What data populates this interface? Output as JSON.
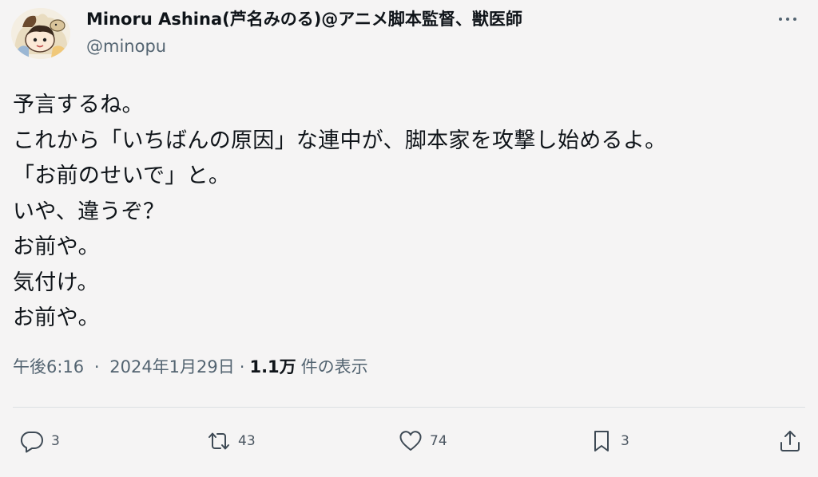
{
  "author": {
    "display_name": "Minoru Ashina(芦名みのる)@アニメ脚本監督、獣医師",
    "handle": "@minopu"
  },
  "more_icon": "more-horizontal-icon",
  "tweet": {
    "lines": [
      "予言するね。",
      "これから「いちばんの原因」な連中が、脚本家を攻撃し始めるよ。",
      "「お前のせいで」と。",
      "いや、違うぞ？",
      "お前や。",
      "気付け。",
      "お前や。"
    ]
  },
  "meta": {
    "time": "午後6:16",
    "separator": "·",
    "date": "2024年1月29日",
    "views_count": "1.1万",
    "views_label": "件の表示"
  },
  "actions": {
    "reply": {
      "icon": "reply-icon",
      "count": "3"
    },
    "repost": {
      "icon": "repost-icon",
      "count": "43"
    },
    "like": {
      "icon": "heart-icon",
      "count": "74"
    },
    "bookmark": {
      "icon": "bookmark-icon",
      "count": "3"
    },
    "share": {
      "icon": "share-icon"
    }
  },
  "colors": {
    "background": "#f5f4f4",
    "text": "#0f1419",
    "secondary": "#536471"
  }
}
